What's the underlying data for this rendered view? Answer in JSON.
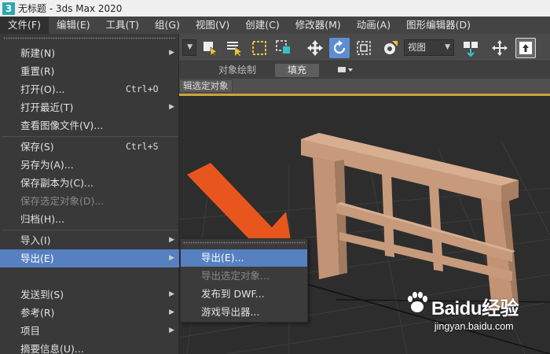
{
  "window": {
    "title": "无标题 - 3ds Max 2020"
  },
  "menubar": {
    "items": [
      "文件(F)",
      "编辑(E)",
      "工具(T)",
      "组(G)",
      "视图(V)",
      "创建(C)",
      "修改器(M)",
      "动画(A)",
      "图形编辑器(D)"
    ]
  },
  "toolbar": {
    "view_dropdown": "视图",
    "icons": [
      "select-icon",
      "select-by-name-icon",
      "rect-region-icon",
      "window-crossing-icon",
      "move-icon",
      "rotate-icon",
      "scale-icon",
      "place-icon",
      "view-dropdown",
      "pivot-icon",
      "snap-move-icon",
      "keyboard-shortcut-icon"
    ]
  },
  "ribbon": {
    "tabs": [
      "对象绘制",
      "填充"
    ],
    "active_tab": "填充"
  },
  "subtitle": {
    "text": "辑选定对象"
  },
  "file_menu": {
    "items": [
      {
        "label": "新建(N)",
        "shortcut": "",
        "submenu": true,
        "enabled": true
      },
      {
        "label": "重置(R)",
        "shortcut": "",
        "submenu": false,
        "enabled": true
      },
      {
        "label": "打开(O)...",
        "shortcut": "Ctrl+O",
        "submenu": false,
        "enabled": true
      },
      {
        "label": "打开最近(T)",
        "shortcut": "",
        "submenu": true,
        "enabled": true
      },
      {
        "label": "查看图像文件(V)...",
        "shortcut": "",
        "submenu": false,
        "enabled": true
      },
      {
        "label": "保存(S)",
        "shortcut": "Ctrl+S",
        "submenu": false,
        "enabled": true
      },
      {
        "label": "另存为(A)...",
        "shortcut": "",
        "submenu": false,
        "enabled": true
      },
      {
        "label": "保存副本为(C)...",
        "shortcut": "",
        "submenu": false,
        "enabled": true
      },
      {
        "label": "保存选定对象(D)...",
        "shortcut": "",
        "submenu": false,
        "enabled": false
      },
      {
        "label": "归档(H)...",
        "shortcut": "",
        "submenu": false,
        "enabled": true
      },
      {
        "label": "导入(I)",
        "shortcut": "",
        "submenu": true,
        "enabled": true
      },
      {
        "label": "导出(E)",
        "shortcut": "",
        "submenu": true,
        "enabled": true,
        "highlighted": true
      },
      {
        "label": "发送到(S)",
        "shortcut": "",
        "submenu": true,
        "enabled": true
      },
      {
        "label": "参考(R)",
        "shortcut": "",
        "submenu": true,
        "enabled": true
      },
      {
        "label": "项目",
        "shortcut": "",
        "submenu": true,
        "enabled": true
      },
      {
        "label": "摘要信息(U)...",
        "shortcut": "",
        "submenu": false,
        "enabled": true
      }
    ]
  },
  "export_submenu": {
    "items": [
      {
        "label": "导出(E)...",
        "enabled": true,
        "highlighted": true
      },
      {
        "label": "导出选定对象...",
        "enabled": false
      },
      {
        "label": "发布到 DWF...",
        "enabled": true
      },
      {
        "label": "游戏导出器...",
        "enabled": true
      }
    ]
  },
  "watermark": {
    "brand": "Baidu经验",
    "url": "jingyan.baidu.com"
  },
  "colors": {
    "menu_highlight": "#5680c0",
    "arrow": "#e8561e",
    "model_wood": "#c79a7c",
    "viewport_bg": "#2d2d2d",
    "viewport_active_border": "#c9a43a"
  }
}
